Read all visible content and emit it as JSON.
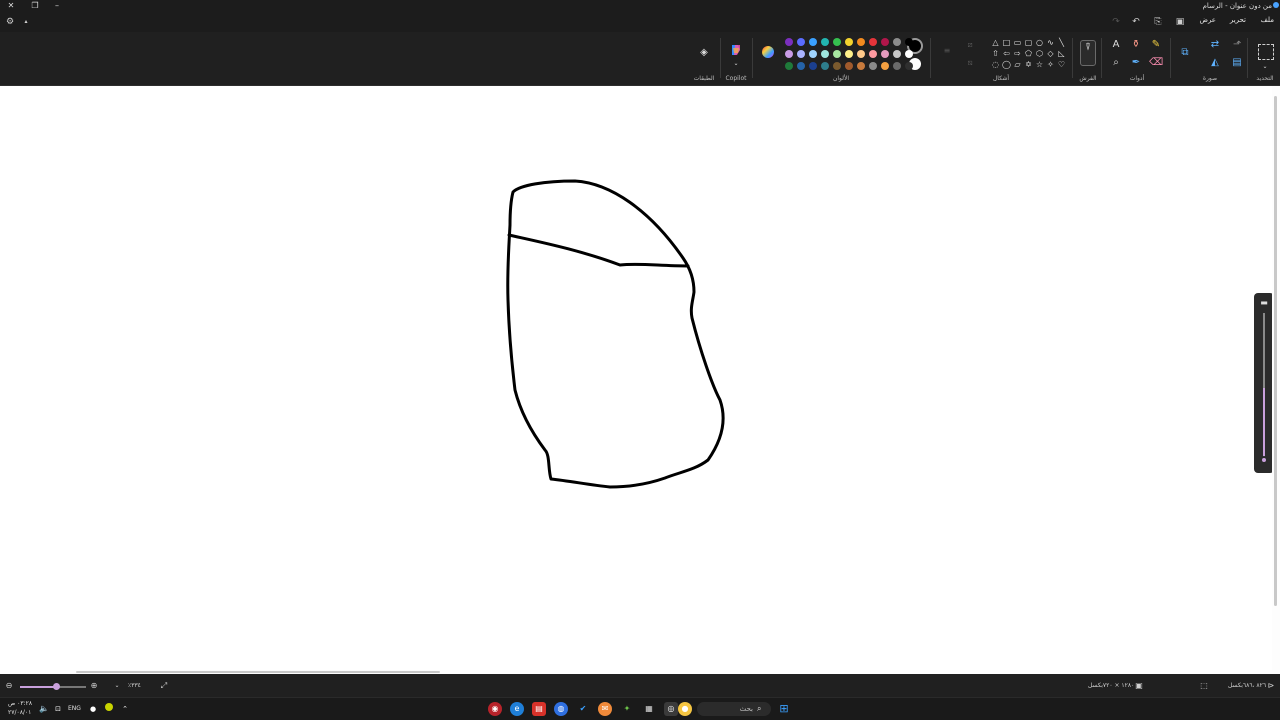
{
  "window": {
    "title": "من دون عنوان - الرسام",
    "minimize_glyph": "–",
    "maximize_glyph": "❐",
    "close_glyph": "✕"
  },
  "menu": {
    "file": "ملف",
    "edit": "تحرير",
    "view": "عرض"
  },
  "ribbon": {
    "selection_label": "التحديد",
    "image_label": "صورة",
    "tools_label": "أدوات",
    "brushes_label": "الفرش",
    "shapes_label": "أشكال",
    "colors_label": "الألوان",
    "copilot_label": "Copilot",
    "layers_label": "الطبقات"
  },
  "palette": {
    "primary": "#000000",
    "secondary": "#ffffff",
    "row1": [
      "#7b2fbe",
      "#5a6cff",
      "#3aa0ff",
      "#22b5b0",
      "#35c04f",
      "#f2d22e",
      "#f28a1f",
      "#e5343a",
      "#b0164a",
      "#8c8c8c",
      "#000000"
    ],
    "row2": [
      "#c99ce6",
      "#a9b3ff",
      "#9fd4ff",
      "#9fe6df",
      "#a7e6a0",
      "#fff08a",
      "#ffc98a",
      "#ff9aa0",
      "#e59bbd",
      "#c8c8c8",
      "#ffffff"
    ],
    "row3": [
      "#1f7a3a",
      "#2563a8",
      "#1b3f8f",
      "#2e7d8c",
      "#7a5a2e",
      "#a05a2c",
      "#c77a3c",
      "#8a8a8a",
      "#f5a040",
      "#6b6b6b",
      "#2f2f2f"
    ]
  },
  "status": {
    "zoom": "٣٣٤٪",
    "canvas_size": "١٢٨٠ × ٧٢٠بكسل",
    "selection_size": "٨٢٦ ،٦٨٦بكسل"
  },
  "taskbar": {
    "search_placeholder": "بحث",
    "language": "ENG",
    "time": "٠٣:٢٨ ص",
    "date": "٢٧/٠٨/٠١"
  }
}
